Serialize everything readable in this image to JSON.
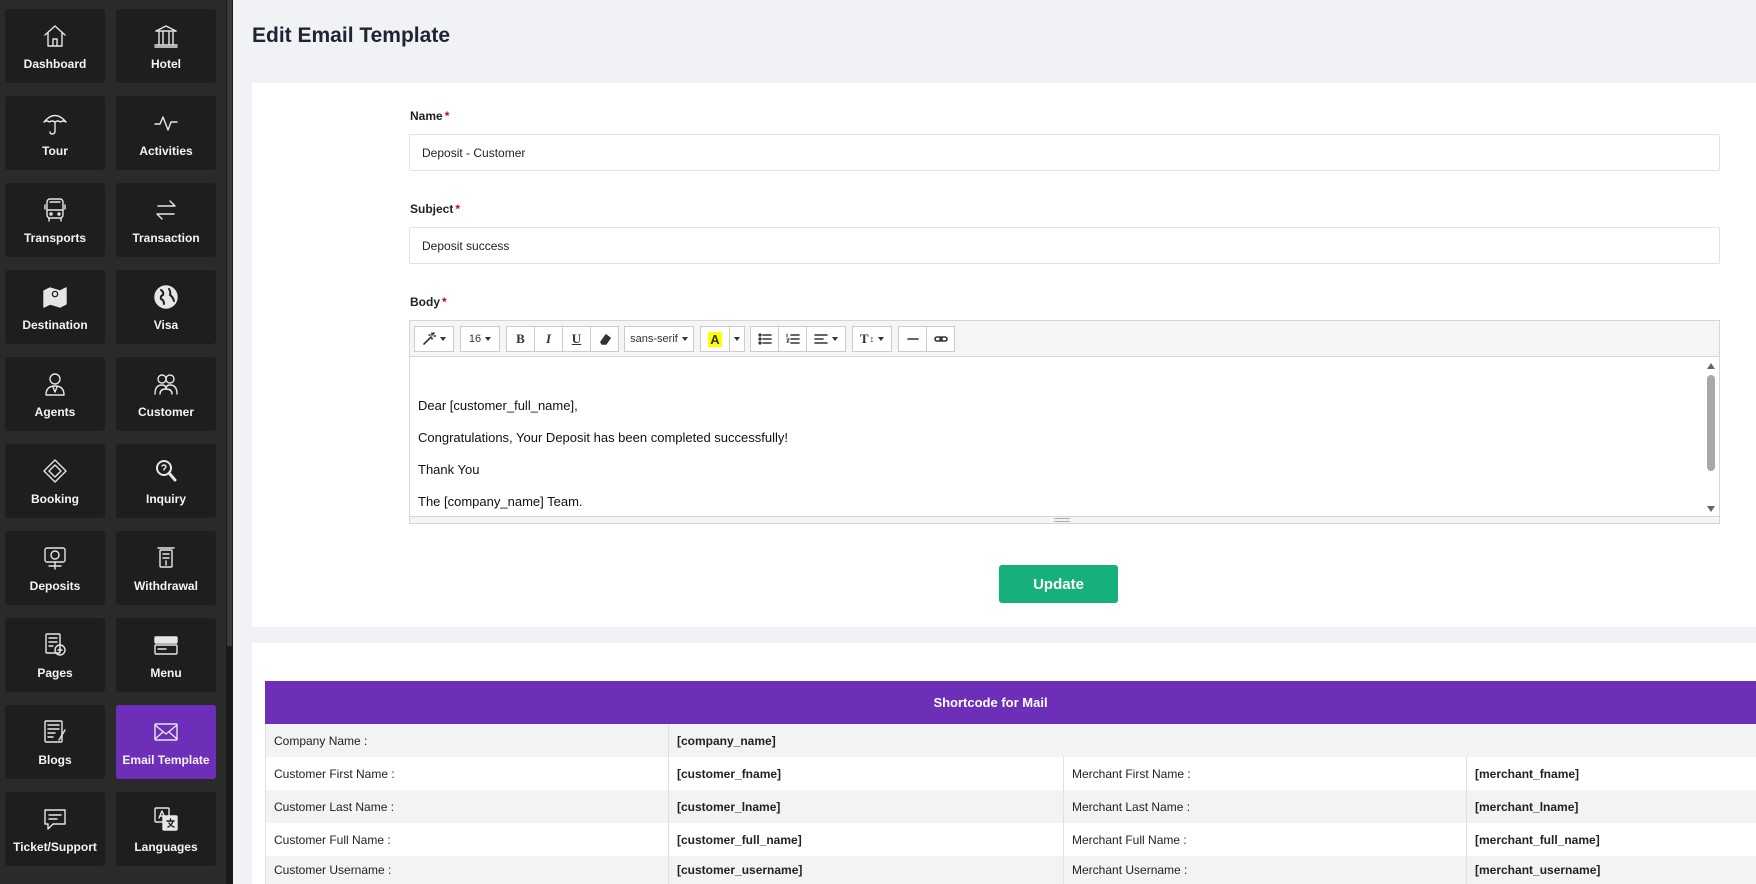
{
  "sidebar": {
    "items": [
      {
        "label": "Dashboard",
        "icon": "home-icon",
        "active": false
      },
      {
        "label": "Hotel",
        "icon": "building-icon",
        "active": false
      },
      {
        "label": "Tour",
        "icon": "umbrella-icon",
        "active": false
      },
      {
        "label": "Activities",
        "icon": "activity-icon",
        "active": false
      },
      {
        "label": "Transports",
        "icon": "bus-icon",
        "active": false
      },
      {
        "label": "Transaction",
        "icon": "exchange-icon",
        "active": false
      },
      {
        "label": "Destination",
        "icon": "map-icon",
        "active": false
      },
      {
        "label": "Visa",
        "icon": "globe-icon",
        "active": false
      },
      {
        "label": "Agents",
        "icon": "agent-icon",
        "active": false
      },
      {
        "label": "Customer",
        "icon": "users-icon",
        "active": false
      },
      {
        "label": "Booking",
        "icon": "diamond-icon",
        "active": false
      },
      {
        "label": "Inquiry",
        "icon": "magnifier-icon",
        "active": false
      },
      {
        "label": "Deposits",
        "icon": "deposit-icon",
        "active": false
      },
      {
        "label": "Withdrawal",
        "icon": "atm-icon",
        "active": false
      },
      {
        "label": "Pages",
        "icon": "pages-icon",
        "active": false
      },
      {
        "label": "Menu",
        "icon": "menu-icon",
        "active": false
      },
      {
        "label": "Blogs",
        "icon": "blog-icon",
        "active": false
      },
      {
        "label": "Email Template",
        "icon": "envelope-icon",
        "active": true
      },
      {
        "label": "Ticket/Support",
        "icon": "chat-icon",
        "active": false
      },
      {
        "label": "Languages",
        "icon": "translate-icon",
        "active": false
      }
    ]
  },
  "page": {
    "title": "Edit Email Template"
  },
  "form": {
    "name_label": "Name",
    "name_value": "Deposit - Customer",
    "subject_label": "Subject",
    "subject_value": "Deposit success",
    "body_label": "Body",
    "required_mark": "*",
    "toolbar": {
      "font_size": "16",
      "font_family": "sans-serif",
      "bold": "B",
      "italic": "I",
      "underline": "U",
      "highlight": "A",
      "text_height": "T"
    },
    "body_lines": [
      "Dear [customer_full_name],",
      "Congratulations, Your Deposit has been completed successfully!",
      "Thank You",
      "The [company_name] Team."
    ],
    "update_label": "Update"
  },
  "shortcodes": {
    "title": "Shortcode for Mail",
    "company": {
      "label": "Company Name :",
      "code": "[company_name]"
    },
    "rows": [
      {
        "c_label": "Customer First Name :",
        "c_code": "[customer_fname]",
        "m_label": "Merchant First Name :",
        "m_code": "[merchant_fname]"
      },
      {
        "c_label": "Customer Last Name :",
        "c_code": "[customer_lname]",
        "m_label": "Merchant Last Name :",
        "m_code": "[merchant_lname]"
      },
      {
        "c_label": "Customer Full Name :",
        "c_code": "[customer_full_name]",
        "m_label": "Merchant Full Name :",
        "m_code": "[merchant_full_name]"
      },
      {
        "c_label": "Customer Username :",
        "c_code": "[customer_username]",
        "m_label": "Merchant Username :",
        "m_code": "[merchant_username]"
      }
    ]
  },
  "colors": {
    "accent": "#6e2fb8",
    "update_button": "#16b07a",
    "sidebar": "#2a2a2a"
  }
}
